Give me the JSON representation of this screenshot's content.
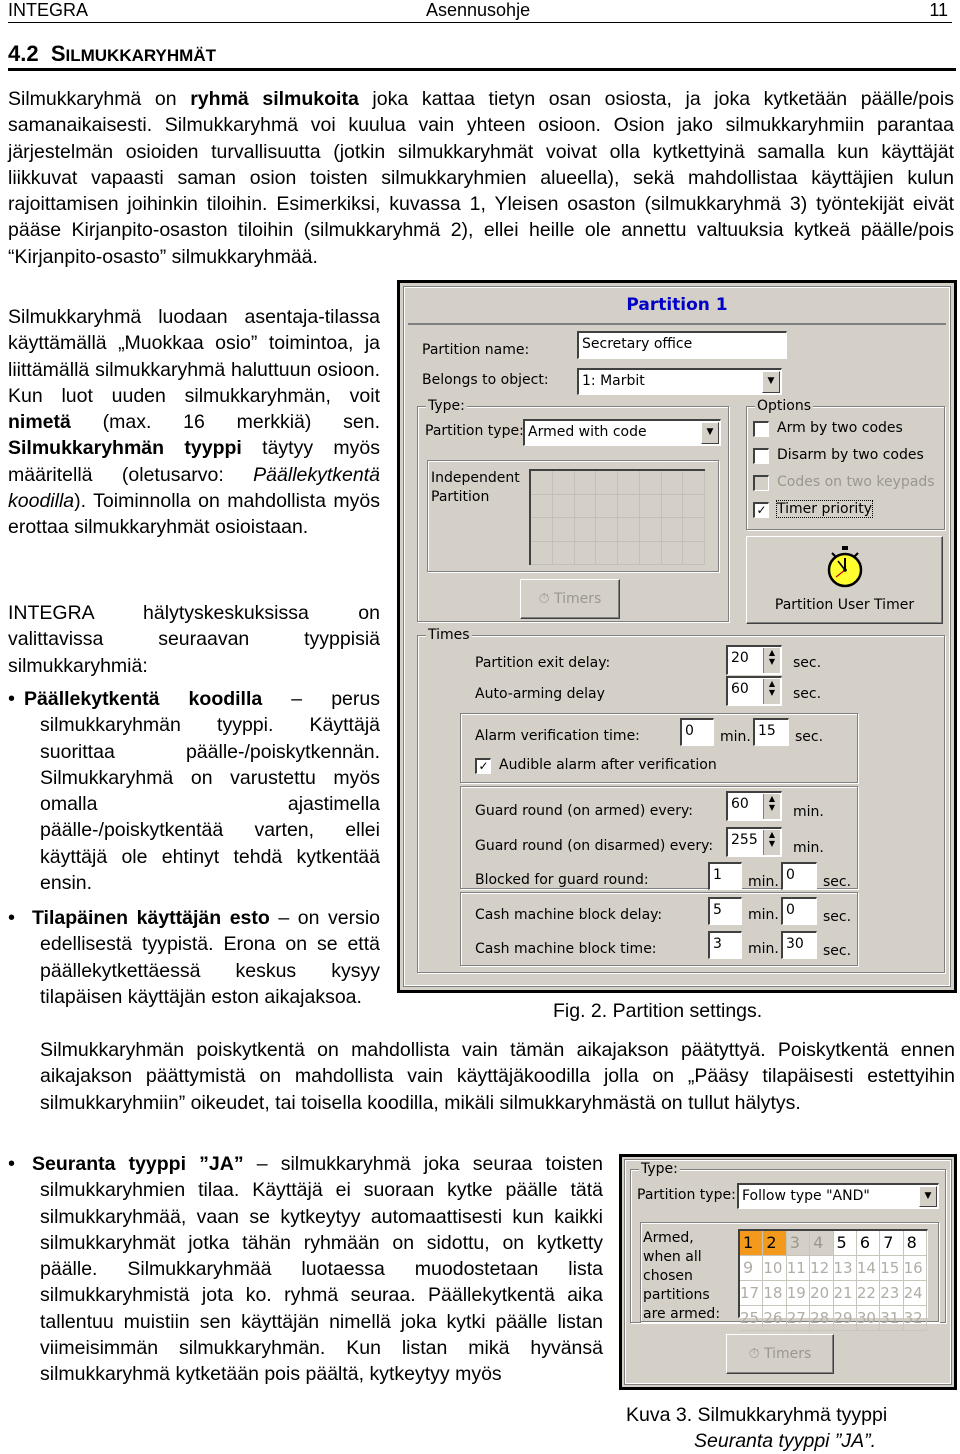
{
  "header": {
    "left": "INTEGRA",
    "center": "Asennusohje",
    "page": "11"
  },
  "section": {
    "number": "4.2",
    "title_first": "S",
    "title_rest": "ILMUKKARYHMÄT"
  },
  "intro": {
    "p1_a": "Silmukkaryhmä on ",
    "p1_b": "ryhmä silmukoita",
    "p1_c": " joka kattaa tietyn osan osiosta, ja joka kytketään päälle/pois samanaikaisesti. Silmukkaryhmä voi kuulua vain yhteen osioon. Osion jako silmukkaryhmiin parantaa järjestelmän osioiden turvallisuutta (jotkin silmukkaryhmät voivat olla kytkettyinä samalla kun käyttäjät liikkuvat vapaasti saman osion toisten silmukkaryhmien alueella), sekä mahdollistaa käyttäjien kulun rajoittamisen joihinkin tiloihin. Esimerkiksi, kuvassa 1, Yleisen osaston (silmukkaryhmä 3) työntekijät eivät pääse Kirjanpito-osaston tiloihin (silmukkaryhmä 2), ellei heille ole annettu valtuuksia kytkeä päälle/pois “Kirjanpito-osasto” silmukkaryhmää."
  },
  "left_col": {
    "p2_a": "Silmukkaryhmä luodaan asentaja-tilassa käyttämällä „Muokkaa osio” toimintoa, ja liittämällä silmukkaryhmä haluttuun osioon. Kun luot uuden silmukkaryhmän, voit ",
    "p2_b": "nimetä",
    "p2_c": " (max. 16 merkkiä) sen. ",
    "p2_d": "Silmukkaryhmän tyyppi",
    "p2_e": " täytyy myös määritellä (oletusarvo: ",
    "p2_f": "Päällekytkentä koodilla",
    "p2_g": "). Toiminnolla on mahdollista myös erottaa silmukkaryhmät osioistaan.",
    "p3": "INTEGRA hälytyskeskuksissa on valittavissa seuraavan tyyppisiä silmukkaryhmiä:"
  },
  "bullets": [
    {
      "title": "Päällekytkentä koodilla",
      "text": " – perus silmukkaryhmän tyyppi. Käyttäjä suorittaa päälle-/poiskytkennän. Silmukkaryhmä on varustettu myös omalla ajastimella päälle-/poiskytkentää varten, ellei käyttäjä ole ehtinyt tehdä kytkentää ensin."
    },
    {
      "title": "Tilapäinen käyttäjän esto",
      "text": " – on versio edellisestä tyypistä. Erona on se että päällekytkettäessä keskus kysyy tilapäisen käyttäjän eston aikajaksoa.",
      "cont": "Silmukkaryhmän poiskytkentä on mahdollista vain tämän aikajakson päätyttyä. Poiskytkentä ennen aikajakson päättymistä on mahdollista vain käyttäjäkoodilla jolla on „Pääsy tilapäisesti estettyihin silmukkaryhmiin” oikeudet, tai toisella koodilla, mikäli silmukkaryhmästä on tullut hälytys."
    },
    {
      "title": "Seuranta tyyppi ”JA”",
      "text": " – silmukkaryhmä joka seuraa toisten silmukkaryhmien tilaa. Käyttäjä ei suoraan kytke päälle tätä silmukkaryhmää, vaan se kytkeytyy automaattisesti kun kaikki silmukkaryhmät jotka tähän ryhmään on sidottu, on kytketty päälle. Silmukkaryhmää luotaessa muodostetaan lista silmukkaryhmistä jota ko. ryhmä seuraa. Päällekytkentä aika tallentuu muistiin sen käyttäjän nimellä joka kytki päälle listan viimeisimmän silmukkaryhmän. Kun listan mikä hyvänsä silmukkaryhmä kytketään pois päältä, kytkeytyy myös"
    }
  ],
  "fig2": {
    "caption": "Fig. 2. Partition settings.",
    "title": "Partition 1",
    "name_label": "Partition name:",
    "name_value": "Secretary office",
    "object_label": "Belongs to object:",
    "object_value": "1: Marbit",
    "type_group": "Type:",
    "type_label": "Partition type:",
    "type_value": "Armed with code",
    "independent_label": "Independent\nPartition",
    "timers_button": "Timers",
    "options_group": "Options",
    "options": [
      {
        "label": "Arm by two codes",
        "checked": false,
        "enabled": true
      },
      {
        "label": "Disarm by two codes",
        "checked": false,
        "enabled": true
      },
      {
        "label": "Codes on two keypads",
        "checked": false,
        "enabled": false
      },
      {
        "label": "Timer priority",
        "checked": true,
        "enabled": true
      }
    ],
    "user_timer_button": "Partition User Timer",
    "times_group": "Times",
    "exit_delay": {
      "label": "Partition exit delay:",
      "value": "20",
      "unit": "sec."
    },
    "auto_arming": {
      "label": "Auto-arming delay",
      "value": "60",
      "unit": "sec."
    },
    "alarm_verification": {
      "label": "Alarm verification time:",
      "min": "0",
      "sec": "15"
    },
    "audible_alarm": {
      "label": "Audible alarm after verification",
      "checked": true
    },
    "guard_armed": {
      "label": "Guard round (on armed) every:",
      "value": "60",
      "unit": "min."
    },
    "guard_disarmed": {
      "label": "Guard round (on disarmed) every:",
      "value": "255",
      "unit": "min."
    },
    "blocked_guard": {
      "label": "Blocked for guard round:",
      "min": "1",
      "sec": "0"
    },
    "cash_delay": {
      "label": "Cash machine block delay:",
      "min": "5",
      "sec": "0"
    },
    "cash_time": {
      "label": "Cash machine block time:",
      "min": "3",
      "sec": "30"
    },
    "min_unit": "min.",
    "sec_unit": "sec."
  },
  "fig3": {
    "caption_line1": "Kuva 3. Silmukkaryhmä tyyppi",
    "caption_line2": "Seuranta tyyppi ”JA”.",
    "type_group": "Type:",
    "type_label": "Partition type:",
    "type_value": "Follow type \"AND\"",
    "armed_label": "Armed, when all chosen partitions are armed:",
    "selected_partitions": [
      1,
      2
    ],
    "unavailable_partitions": [
      3,
      4
    ],
    "available_partitions": [
      5,
      6,
      7,
      8
    ],
    "timers_button": "Timers",
    "accent_color": "#f39a1c"
  }
}
